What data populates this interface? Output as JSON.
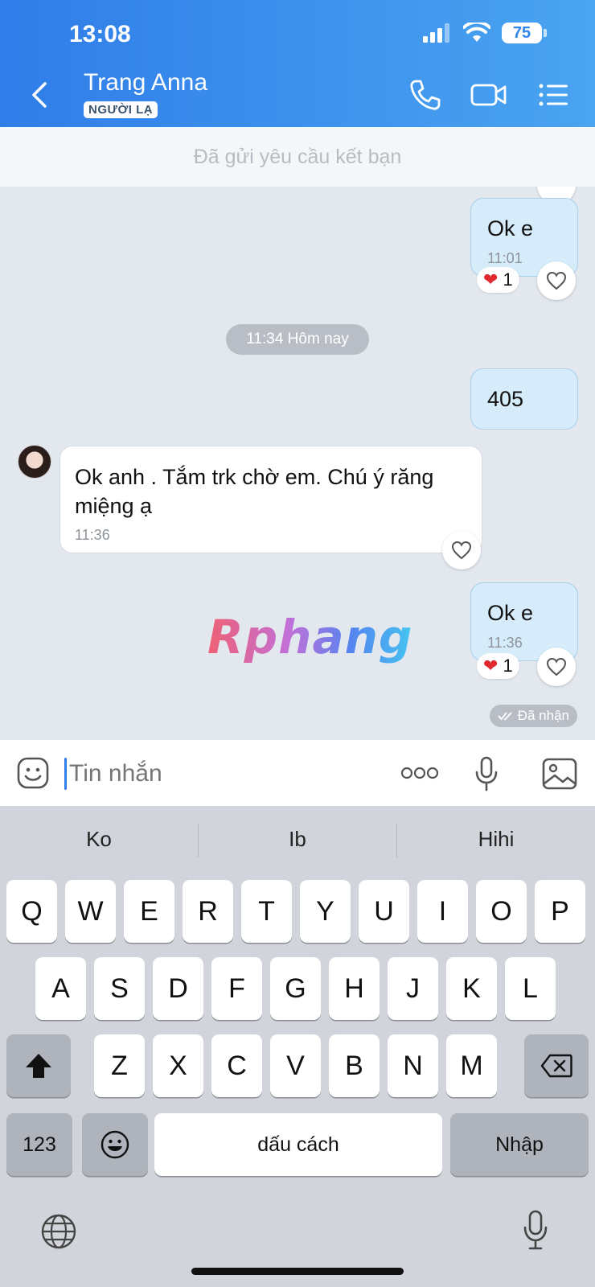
{
  "status_bar": {
    "time": "13:08",
    "battery": "75"
  },
  "header": {
    "contact_name": "Trang Anna",
    "badge": "NGƯỜI LẠ",
    "icons": [
      "back-chevron-icon",
      "phone-icon",
      "video-call-icon",
      "menu-list-icon"
    ]
  },
  "friend_request_text": "Đã gửi yêu cầu kết bạn",
  "messages": [
    {
      "dir": "out",
      "text": "Ok e",
      "time": "11:01",
      "reaction_count": "1"
    },
    {
      "type": "date",
      "text": "11:34 Hôm nay"
    },
    {
      "dir": "out",
      "text": "405"
    },
    {
      "dir": "in",
      "text": "Ok anh . Tắm trk chờ em. Chú ý răng miệng ạ",
      "time": "11:36"
    },
    {
      "dir": "out",
      "text": "Ok e",
      "time": "11:36",
      "reaction_count": "1",
      "status": "Đã nhận"
    }
  ],
  "watermark": "Rphang",
  "input": {
    "placeholder": "Tin nhắn"
  },
  "keyboard": {
    "suggestions": [
      "Ko",
      "Ib",
      "Hihi"
    ],
    "row1": [
      "Q",
      "W",
      "E",
      "R",
      "T",
      "Y",
      "U",
      "I",
      "O",
      "P"
    ],
    "row2": [
      "A",
      "S",
      "D",
      "F",
      "G",
      "H",
      "J",
      "K",
      "L"
    ],
    "row3": [
      "Z",
      "X",
      "C",
      "V",
      "B",
      "N",
      "M"
    ],
    "numbers_label": "123",
    "space_label": "dấu cách",
    "return_label": "Nhập"
  },
  "colors": {
    "header_start": "#2f7de9",
    "header_end": "#4aa4f0",
    "outgoing_bubble": "#d6ecfa",
    "chat_bg": "#e3e8ef"
  }
}
